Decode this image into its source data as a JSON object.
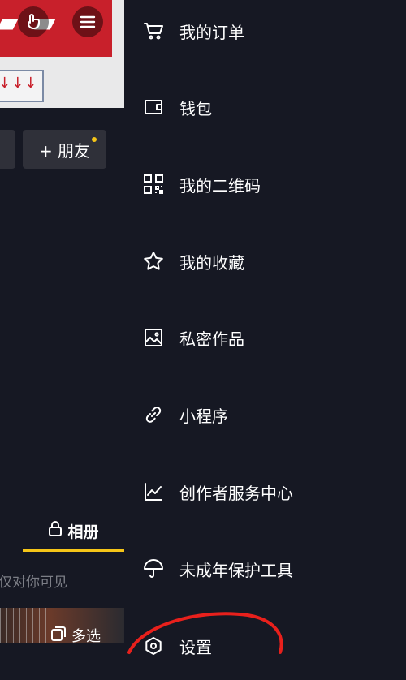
{
  "profile": {
    "add_friend_label": "+ 朋友",
    "album_tab_label": "相册",
    "visibility_note": "仅对你可见",
    "multi_select_label": "多选"
  },
  "drawer": {
    "items": [
      {
        "label": "我的订单",
        "icon": "cart-icon"
      },
      {
        "label": "钱包",
        "icon": "wallet-icon"
      },
      {
        "label": "我的二维码",
        "icon": "qr-code-icon"
      },
      {
        "label": "我的收藏",
        "icon": "star-icon"
      },
      {
        "label": "私密作品",
        "icon": "private-image-icon"
      },
      {
        "label": "小程序",
        "icon": "link-icon"
      },
      {
        "label": "创作者服务中心",
        "icon": "chart-icon"
      },
      {
        "label": "未成年保护工具",
        "icon": "umbrella-icon"
      },
      {
        "label": "设置",
        "icon": "gear-icon"
      }
    ]
  },
  "colors": {
    "background": "#161823",
    "accent": "#f5c518",
    "button_bg": "#2f3039",
    "annotation": "#e8201c"
  }
}
